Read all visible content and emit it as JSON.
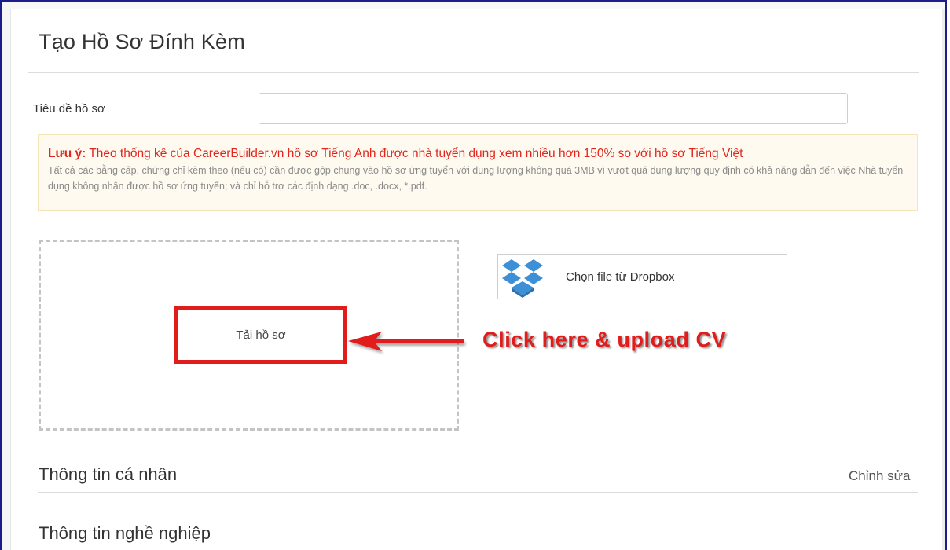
{
  "page": {
    "title": "Tạo Hồ Sơ Đính Kèm"
  },
  "form": {
    "title_field_label": "Tiêu đề hồ sơ",
    "title_field_value": "",
    "title_field_placeholder": ""
  },
  "notice": {
    "prefix": "Lưu ý:",
    "message": " Theo thống kê của CareerBuilder.vn hồ sơ Tiếng Anh được nhà tuyển dụng xem nhiều hơn 150% so với hồ sơ Tiếng Việt",
    "details": "Tất cả các bằng cấp, chứng chỉ kèm theo (nếu có) cần được gộp chung vào hồ sơ ứng tuyển với dung lượng không quá 3MB vì vượt quá dung lượng quy định có khả năng dẫn đến việc Nhà tuyển dụng không nhận được hồ sơ ứng tuyển; và chỉ hỗ trợ các định dạng .doc, .docx, *.pdf.",
    "colors": {
      "accent": "#e0261e",
      "background": "#fffaf0"
    }
  },
  "upload": {
    "button_label": "Tải hồ sơ",
    "dropbox_label": "Chọn file từ Dropbox",
    "dropbox_icon": "dropbox-icon"
  },
  "annotation": {
    "callout_text": "Click here & upload CV",
    "arrow_icon": "arrow-left-icon",
    "color": "#e21b1b"
  },
  "sections": {
    "personal_info": {
      "title": "Thông tin cá nhân",
      "edit_label": "Chỉnh sửa"
    },
    "career_info": {
      "title": "Thông tin nghề nghiệp"
    }
  }
}
